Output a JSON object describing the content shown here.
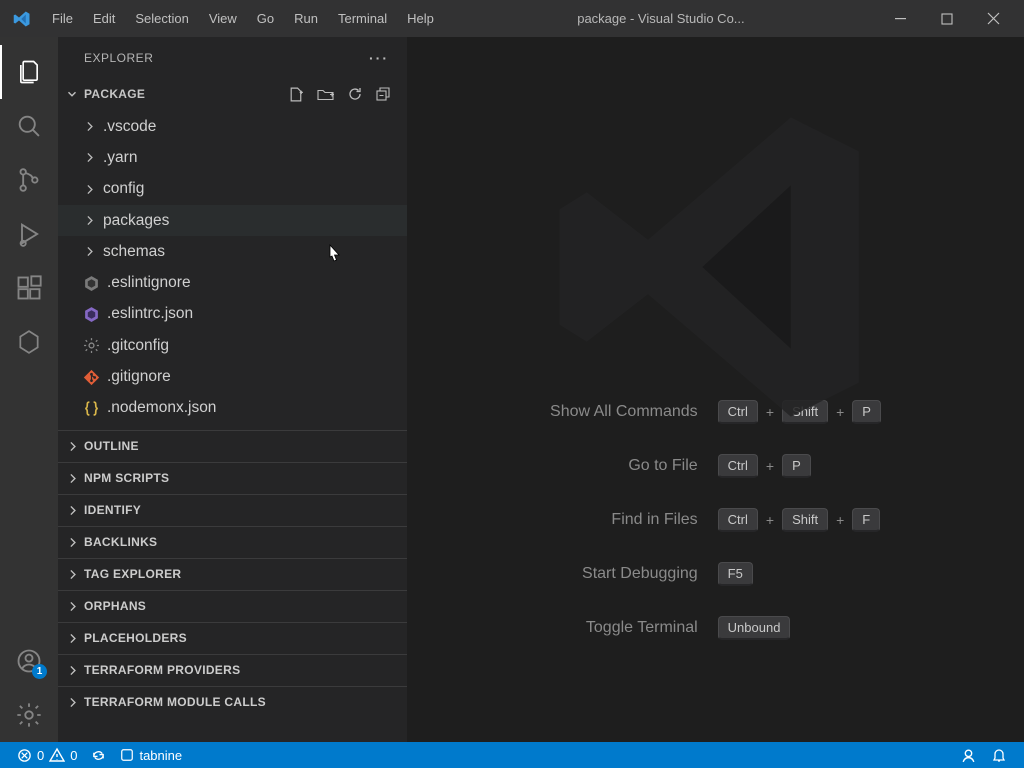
{
  "title": "package - Visual Studio Co...",
  "menu": [
    "File",
    "Edit",
    "Selection",
    "View",
    "Go",
    "Run",
    "Terminal",
    "Help"
  ],
  "sidebar": {
    "title": "EXPLORER",
    "project": "PACKAGE",
    "tree": [
      {
        "type": "folder",
        "name": ".vscode"
      },
      {
        "type": "folder",
        "name": ".yarn"
      },
      {
        "type": "folder",
        "name": "config"
      },
      {
        "type": "folder",
        "name": "packages",
        "hover": true
      },
      {
        "type": "folder",
        "name": "schemas"
      },
      {
        "type": "file",
        "name": ".eslintignore",
        "icon": "eslint-gray"
      },
      {
        "type": "file",
        "name": ".eslintrc.json",
        "icon": "eslint-purple"
      },
      {
        "type": "file",
        "name": ".gitconfig",
        "icon": "gear-gray"
      },
      {
        "type": "file",
        "name": ".gitignore",
        "icon": "git-orange"
      },
      {
        "type": "file",
        "name": ".nodemonx.json",
        "icon": "braces-yellow"
      }
    ],
    "sections": [
      "OUTLINE",
      "NPM SCRIPTS",
      "IDENTIFY",
      "BACKLINKS",
      "TAG EXPLORER",
      "ORPHANS",
      "PLACEHOLDERS",
      "TERRAFORM PROVIDERS",
      "TERRAFORM MODULE CALLS"
    ]
  },
  "activity": {
    "accountsBadge": "1"
  },
  "welcome": {
    "shortcuts": [
      {
        "label": "Show All Commands",
        "keys": [
          "Ctrl",
          "+",
          "Shift",
          "+",
          "P"
        ]
      },
      {
        "label": "Go to File",
        "keys": [
          "Ctrl",
          "+",
          "P"
        ]
      },
      {
        "label": "Find in Files",
        "keys": [
          "Ctrl",
          "+",
          "Shift",
          "+",
          "F"
        ]
      },
      {
        "label": "Start Debugging",
        "keys": [
          "F5"
        ]
      },
      {
        "label": "Toggle Terminal",
        "keys": [
          "Unbound"
        ]
      }
    ]
  },
  "status": {
    "errors": "0",
    "warnings": "0",
    "tabnine": "tabnine"
  }
}
